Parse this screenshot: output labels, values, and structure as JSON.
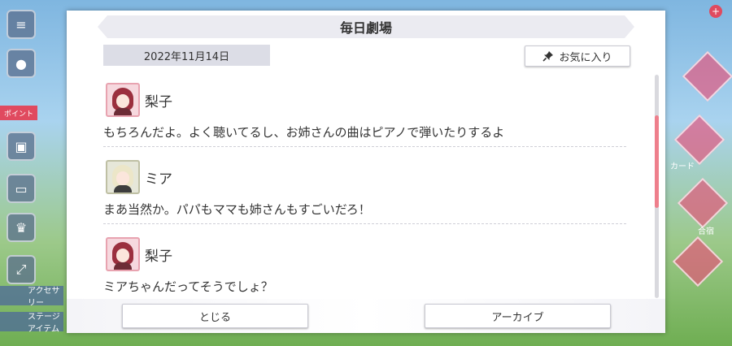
{
  "dialog": {
    "title": "毎日劇場",
    "date": "2022年11月14日",
    "favorite_label": "お気に入り",
    "close_label": "とじる",
    "archive_label": "アーカイブ"
  },
  "messages": [
    {
      "speaker": "梨子",
      "text": "もちろんだよ。よく聴いてるし、お姉さんの曲はピアノで弾いたりするよ"
    },
    {
      "speaker": "ミア",
      "text": "まあ当然か。パパもママも姉さんもすごいだろ！"
    },
    {
      "speaker": "梨子",
      "text": "ミアちゃんだってそうでしょ？"
    }
  ],
  "background": {
    "left_tags": [
      "アクセサリー",
      "ステージアイテム"
    ],
    "red_tag": "ポイント",
    "right_texts": [
      "カード",
      "合宿"
    ]
  },
  "colors": {
    "scroll_thumb": "#ee7f8c",
    "date_box": "#dcdde6",
    "title_bar": "#ebebf1"
  }
}
